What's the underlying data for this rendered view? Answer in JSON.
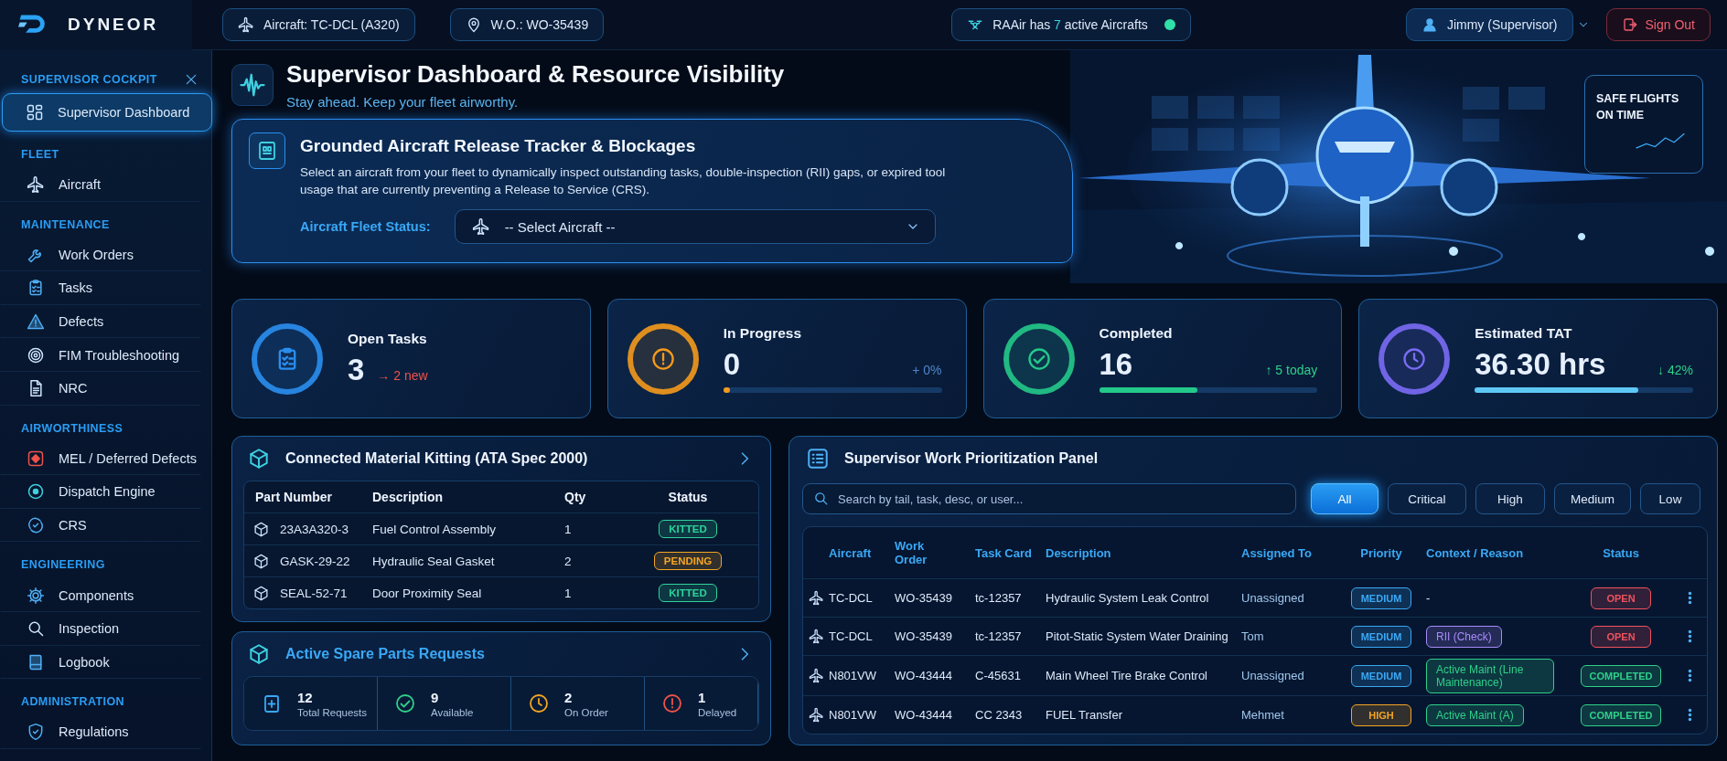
{
  "brand": {
    "name": "DYNEOR"
  },
  "topbar": {
    "aircraft_chip": "Aircraft: TC-DCL (A320)",
    "work_order_chip": "W.O.: WO-35439",
    "fleet": {
      "prefix": "RAAir has",
      "count": "7",
      "suffix": "active Aircrafts",
      "online": true
    },
    "user": "Jimmy (Supervisor)",
    "sign_out": "Sign Out"
  },
  "sidebar": {
    "sections": [
      {
        "title": "SUPERVISOR COCKPIT",
        "items": [
          {
            "label": "Supervisor Dashboard",
            "selected": true
          }
        ]
      },
      {
        "title": "FLEET",
        "items": [
          {
            "label": "Aircraft",
            "selected": false
          }
        ]
      },
      {
        "title": "MAINTENANCE",
        "items": [
          {
            "label": "Work Orders",
            "selected": false
          },
          {
            "label": "Tasks",
            "selected": false
          },
          {
            "label": "Defects",
            "selected": false
          },
          {
            "label": "FIM Troubleshooting",
            "selected": false
          },
          {
            "label": "NRC",
            "selected": false
          }
        ]
      },
      {
        "title": "AIRWORTHINESS",
        "items": [
          {
            "label": "MEL / Deferred Defects",
            "selected": false
          },
          {
            "label": "Dispatch Engine",
            "selected": false
          },
          {
            "label": "CRS",
            "selected": false
          }
        ]
      },
      {
        "title": "ENGINEERING",
        "items": [
          {
            "label": "Components",
            "selected": false
          },
          {
            "label": "Inspection",
            "selected": false
          },
          {
            "label": "Logbook",
            "selected": false
          }
        ]
      },
      {
        "title": "ADMINISTRATION",
        "items": [
          {
            "label": "Regulations",
            "selected": false
          }
        ]
      }
    ]
  },
  "header": {
    "title": "Supervisor Dashboard & Resource Visibility",
    "subtitle": "Stay ahead. Keep your fleet airworthy.",
    "banner": "SAFE FLIGHTS ON TIME"
  },
  "release_tracker": {
    "title": "Grounded Aircraft Release Tracker & Blockages",
    "description": "Select an aircraft from your fleet to dynamically inspect outstanding tasks, double-inspection (RII) gaps, or expired tool usage that are currently preventing a Release to Service (CRS).",
    "field_label": "Aircraft Fleet Status:",
    "select_value": "-- Select Aircraft --"
  },
  "kpis": [
    {
      "title": "Open Tasks",
      "value": "3",
      "delta": "→ 2 new",
      "color": "#f0524a"
    },
    {
      "title": "In Progress",
      "value": "0",
      "delta": "+ 0%",
      "color": "#4f86c9",
      "level": 0.03
    },
    {
      "title": "Completed",
      "value": "16",
      "delta": "↑ 5 today",
      "color": "#2fd08a",
      "level": 0.45
    },
    {
      "title": "Estimated TAT",
      "value": "36.30 hrs",
      "delta": "↓ 42%",
      "color": "#2fd08a",
      "level": 0.75
    }
  ],
  "kitting": {
    "title": "Connected Material Kitting (ATA Spec 2000)",
    "columns": [
      "Part Number",
      "Description",
      "Qty",
      "Status"
    ],
    "rows": [
      {
        "part": "23A3A320-3",
        "description": "Fuel Control Assembly",
        "qty": "1",
        "status": "KITTED",
        "color": "#2fd39a"
      },
      {
        "part": "GASK-29-22",
        "description": "Hydraulic Seal Gasket",
        "qty": "2",
        "status": "PENDING",
        "color": "#f5a524"
      },
      {
        "part": "SEAL-52-71",
        "description": "Door Proximity Seal",
        "qty": "1",
        "status": "KITTED",
        "color": "#2fd39a"
      }
    ]
  },
  "spare_requests": {
    "title": "Active Spare Parts Requests",
    "stats": [
      {
        "count": "12",
        "label": "Total Requests"
      },
      {
        "count": "9",
        "label": "Available"
      },
      {
        "count": "2",
        "label": "On Order"
      },
      {
        "count": "1",
        "label": "Delayed"
      }
    ]
  },
  "work_panel": {
    "title": "Supervisor Work Prioritization Panel",
    "search_placeholder": "Search by tail, task, desc, or user...",
    "filters": [
      {
        "label": "All",
        "selected": true
      },
      {
        "label": "Critical",
        "selected": false
      },
      {
        "label": "High",
        "selected": false
      },
      {
        "label": "Medium",
        "selected": false
      },
      {
        "label": "Low",
        "selected": false
      }
    ],
    "columns": [
      "Aircraft",
      "Work Order",
      "Task Card",
      "Description",
      "Assigned To",
      "Priority",
      "Context / Reason",
      "Status"
    ],
    "rows": [
      {
        "aircraft": "TC-DCL",
        "work_order": "WO-35439",
        "task_card": "tc-12357",
        "description": "Hydraulic System Leak Control",
        "assigned_to": "Unassigned",
        "priority": {
          "text": "MEDIUM",
          "color": "#3aa8f5"
        },
        "context": {
          "text": "-"
        },
        "status": {
          "text": "OPEN",
          "color": "#f0525e"
        }
      },
      {
        "aircraft": "TC-DCL",
        "work_order": "WO-35439",
        "task_card": "tc-12357",
        "description": "Pitot-Static System Water Draining",
        "assigned_to": "Tom",
        "priority": {
          "text": "MEDIUM",
          "color": "#3aa8f5"
        },
        "context": {
          "text": "RII (Check)",
          "color": "#a78bfa"
        },
        "status": {
          "text": "OPEN",
          "color": "#f0525e"
        }
      },
      {
        "aircraft": "N801VW",
        "work_order": "WO-43444",
        "task_card": "C-45631",
        "description": "Main Wheel Tire Brake Control",
        "assigned_to": "Unassigned",
        "priority": {
          "text": "MEDIUM",
          "color": "#3aa8f5"
        },
        "context": {
          "text": "Active Maint (Line Maintenance)",
          "color": "#2fd08a"
        },
        "status": {
          "text": "COMPLETED",
          "color": "#2fd08a"
        }
      },
      {
        "aircraft": "N801VW",
        "work_order": "WO-43444",
        "task_card": "CC 2343",
        "description": "FUEL Transfer",
        "assigned_to": "Mehmet",
        "priority": {
          "text": "HIGH",
          "color": "#f5a524"
        },
        "context": {
          "text": "Active Maint (A)",
          "color": "#2fd08a"
        },
        "status": {
          "text": "COMPLETED",
          "color": "#2fd08a"
        }
      }
    ]
  }
}
